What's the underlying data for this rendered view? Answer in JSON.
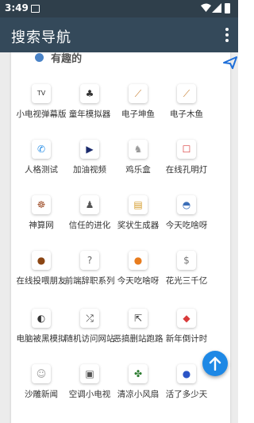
{
  "status": {
    "time": "3:49"
  },
  "toolbar": {
    "title": "搜索导航",
    "menu_icon": "more-vert-icon"
  },
  "section": {
    "title": "有趣的",
    "icon": "section-logo-icon",
    "send_icon": "send-icon"
  },
  "items": [
    {
      "label": "小电视弹幕版",
      "icon": "tv-icon",
      "glyph": "TV"
    },
    {
      "label": "童年模拟器",
      "icon": "kids-icon",
      "glyph": "♣"
    },
    {
      "label": "电子坤鱼",
      "icon": "stick-icon",
      "glyph": "⟋"
    },
    {
      "label": "电子木鱼",
      "icon": "stick-icon",
      "glyph": "⟋"
    },
    {
      "label": "人格测试",
      "icon": "messenger-icon",
      "glyph": "✆"
    },
    {
      "label": "加油视频",
      "icon": "play-icon",
      "glyph": "▶"
    },
    {
      "label": "鸡乐盒",
      "icon": "chicken-icon",
      "glyph": "♞"
    },
    {
      "label": "在线孔明灯",
      "icon": "lantern-icon",
      "glyph": "☐"
    },
    {
      "label": "神算网",
      "icon": "dharma-icon",
      "glyph": "☸"
    },
    {
      "label": "信任的进化",
      "icon": "pyramid-icon",
      "glyph": "♟"
    },
    {
      "label": "奖状生成器",
      "icon": "certificate-icon",
      "glyph": "▤"
    },
    {
      "label": "今天吃啥呀",
      "icon": "bowl-icon",
      "glyph": "◓"
    },
    {
      "label": "在线投喂朋友",
      "icon": "poop-icon",
      "glyph": "●"
    },
    {
      "label": "前端辞职系列",
      "icon": "question-icon",
      "glyph": "?"
    },
    {
      "label": "今天吃啥呀",
      "icon": "orange-icon",
      "glyph": "●"
    },
    {
      "label": "花光三千亿",
      "icon": "coin-icon",
      "glyph": "$"
    },
    {
      "label": "电脑被黑模拟",
      "icon": "mask-icon",
      "glyph": "◐"
    },
    {
      "label": "随机访问网站",
      "icon": "shuffle-icon",
      "glyph": "⤮"
    },
    {
      "label": "恶搞删站跑路",
      "icon": "exit-icon",
      "glyph": "⇱"
    },
    {
      "label": "新年倒计时",
      "icon": "red-packet-icon",
      "glyph": "◆"
    },
    {
      "label": "沙雕新闻",
      "icon": "robot-icon",
      "glyph": "☺"
    },
    {
      "label": "空调小电视",
      "icon": "tv-small-icon",
      "glyph": "▣"
    },
    {
      "label": "清凉小风扇",
      "icon": "fan-icon",
      "glyph": "✤"
    },
    {
      "label": "活了多少天",
      "icon": "face-icon",
      "glyph": "●"
    }
  ],
  "colors": {
    "toolbar": "#34495a",
    "statusbar": "#2f3f4b",
    "fab": "#1e88e5",
    "send": "#1e6fd9"
  },
  "fab": {
    "icon": "arrow-up-icon"
  }
}
